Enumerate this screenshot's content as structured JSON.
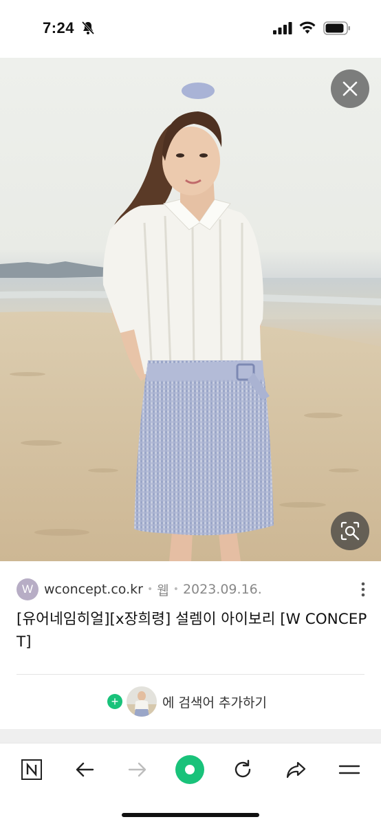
{
  "status_bar": {
    "time": "7:24"
  },
  "result": {
    "favicon_letter": "W",
    "domain": "wconcept.co.kr",
    "type": "웹",
    "date": "2023.09.16.",
    "title": "[유어네임히얼][x장희령] 설렘이 아이보리 [W CONCEPT]",
    "add_search_label": "에 검색어 추가하기"
  },
  "icons": {
    "close": "close-icon",
    "lens": "image-search-icon",
    "more": "more-vertical-icon",
    "nav": [
      "naver-n-icon",
      "back-arrow-icon",
      "forward-arrow-icon",
      "green-dot-home-icon",
      "refresh-icon",
      "share-icon",
      "menu-icon"
    ]
  },
  "colors": {
    "accent_green": "#19c27a",
    "favicon_bg": "#b7adc5",
    "overlay_button": "#505050"
  }
}
